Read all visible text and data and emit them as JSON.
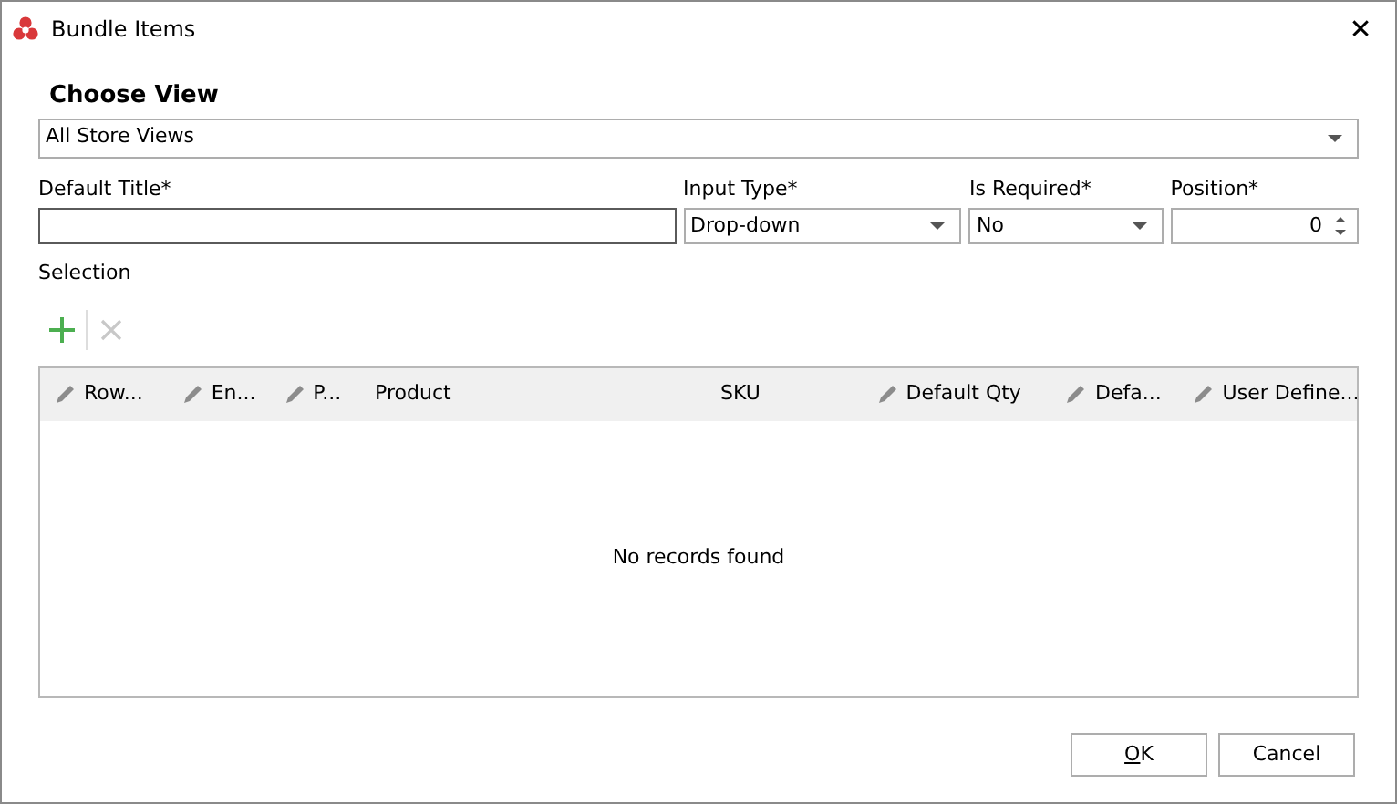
{
  "window": {
    "title": "Bundle Items",
    "close": "✕"
  },
  "choose_view": {
    "heading": "Choose View",
    "value": "All Store Views"
  },
  "fields": [
    {
      "label": "Default Title*",
      "kind": "text",
      "focused": true
    },
    {
      "label": "Input Type*",
      "kind": "dropdown",
      "value": "Drop-down"
    },
    {
      "label": "Is Required*",
      "kind": "dropdown",
      "value": "No"
    },
    {
      "label": "Position*",
      "kind": "spinner",
      "value": "0"
    }
  ],
  "selection": {
    "label": "Selection",
    "toolbar": [
      {
        "kind": "add",
        "disabled": false
      },
      {
        "kind": "delete",
        "disabled": true
      }
    ]
  },
  "table": {
    "columns": [
      {
        "label": "Row...",
        "editable": true
      },
      {
        "label": "En...",
        "editable": true
      },
      {
        "label": "P...",
        "editable": true
      },
      {
        "label": "Product",
        "editable": false
      },
      {
        "label": "SKU",
        "editable": false
      },
      {
        "label": "Default Qty",
        "editable": true
      },
      {
        "label": "Defa...",
        "editable": true
      },
      {
        "label": "User Define...",
        "editable": true
      }
    ],
    "empty_text": "No records found"
  },
  "buttons": [
    {
      "label": "OK",
      "mnemonic": true
    },
    {
      "label": "Cancel",
      "mnemonic": false
    }
  ]
}
